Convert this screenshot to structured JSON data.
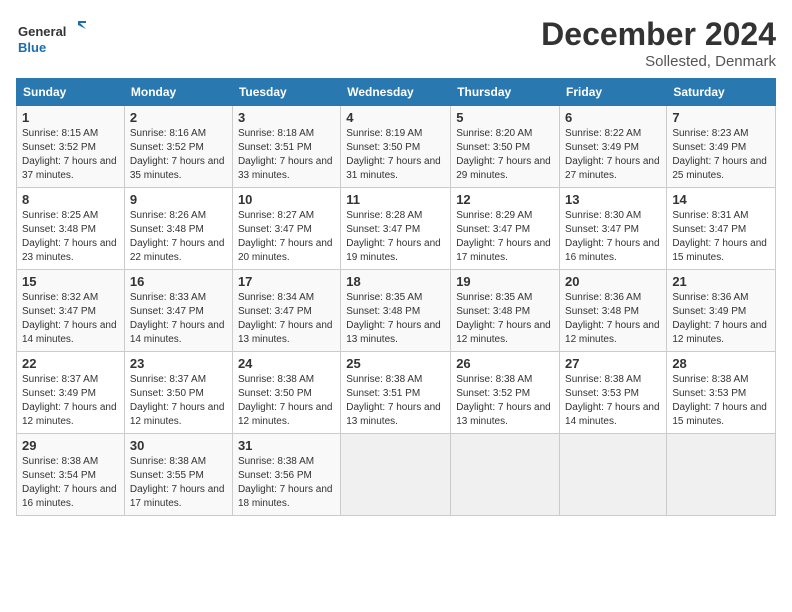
{
  "header": {
    "logo_general": "General",
    "logo_blue": "Blue",
    "month_title": "December 2024",
    "location": "Sollested, Denmark"
  },
  "columns": [
    "Sunday",
    "Monday",
    "Tuesday",
    "Wednesday",
    "Thursday",
    "Friday",
    "Saturday"
  ],
  "weeks": [
    [
      {
        "day": "1",
        "sunrise": "Sunrise: 8:15 AM",
        "sunset": "Sunset: 3:52 PM",
        "daylight": "Daylight: 7 hours and 37 minutes."
      },
      {
        "day": "2",
        "sunrise": "Sunrise: 8:16 AM",
        "sunset": "Sunset: 3:52 PM",
        "daylight": "Daylight: 7 hours and 35 minutes."
      },
      {
        "day": "3",
        "sunrise": "Sunrise: 8:18 AM",
        "sunset": "Sunset: 3:51 PM",
        "daylight": "Daylight: 7 hours and 33 minutes."
      },
      {
        "day": "4",
        "sunrise": "Sunrise: 8:19 AM",
        "sunset": "Sunset: 3:50 PM",
        "daylight": "Daylight: 7 hours and 31 minutes."
      },
      {
        "day": "5",
        "sunrise": "Sunrise: 8:20 AM",
        "sunset": "Sunset: 3:50 PM",
        "daylight": "Daylight: 7 hours and 29 minutes."
      },
      {
        "day": "6",
        "sunrise": "Sunrise: 8:22 AM",
        "sunset": "Sunset: 3:49 PM",
        "daylight": "Daylight: 7 hours and 27 minutes."
      },
      {
        "day": "7",
        "sunrise": "Sunrise: 8:23 AM",
        "sunset": "Sunset: 3:49 PM",
        "daylight": "Daylight: 7 hours and 25 minutes."
      }
    ],
    [
      {
        "day": "8",
        "sunrise": "Sunrise: 8:25 AM",
        "sunset": "Sunset: 3:48 PM",
        "daylight": "Daylight: 7 hours and 23 minutes."
      },
      {
        "day": "9",
        "sunrise": "Sunrise: 8:26 AM",
        "sunset": "Sunset: 3:48 PM",
        "daylight": "Daylight: 7 hours and 22 minutes."
      },
      {
        "day": "10",
        "sunrise": "Sunrise: 8:27 AM",
        "sunset": "Sunset: 3:47 PM",
        "daylight": "Daylight: 7 hours and 20 minutes."
      },
      {
        "day": "11",
        "sunrise": "Sunrise: 8:28 AM",
        "sunset": "Sunset: 3:47 PM",
        "daylight": "Daylight: 7 hours and 19 minutes."
      },
      {
        "day": "12",
        "sunrise": "Sunrise: 8:29 AM",
        "sunset": "Sunset: 3:47 PM",
        "daylight": "Daylight: 7 hours and 17 minutes."
      },
      {
        "day": "13",
        "sunrise": "Sunrise: 8:30 AM",
        "sunset": "Sunset: 3:47 PM",
        "daylight": "Daylight: 7 hours and 16 minutes."
      },
      {
        "day": "14",
        "sunrise": "Sunrise: 8:31 AM",
        "sunset": "Sunset: 3:47 PM",
        "daylight": "Daylight: 7 hours and 15 minutes."
      }
    ],
    [
      {
        "day": "15",
        "sunrise": "Sunrise: 8:32 AM",
        "sunset": "Sunset: 3:47 PM",
        "daylight": "Daylight: 7 hours and 14 minutes."
      },
      {
        "day": "16",
        "sunrise": "Sunrise: 8:33 AM",
        "sunset": "Sunset: 3:47 PM",
        "daylight": "Daylight: 7 hours and 14 minutes."
      },
      {
        "day": "17",
        "sunrise": "Sunrise: 8:34 AM",
        "sunset": "Sunset: 3:47 PM",
        "daylight": "Daylight: 7 hours and 13 minutes."
      },
      {
        "day": "18",
        "sunrise": "Sunrise: 8:35 AM",
        "sunset": "Sunset: 3:48 PM",
        "daylight": "Daylight: 7 hours and 13 minutes."
      },
      {
        "day": "19",
        "sunrise": "Sunrise: 8:35 AM",
        "sunset": "Sunset: 3:48 PM",
        "daylight": "Daylight: 7 hours and 12 minutes."
      },
      {
        "day": "20",
        "sunrise": "Sunrise: 8:36 AM",
        "sunset": "Sunset: 3:48 PM",
        "daylight": "Daylight: 7 hours and 12 minutes."
      },
      {
        "day": "21",
        "sunrise": "Sunrise: 8:36 AM",
        "sunset": "Sunset: 3:49 PM",
        "daylight": "Daylight: 7 hours and 12 minutes."
      }
    ],
    [
      {
        "day": "22",
        "sunrise": "Sunrise: 8:37 AM",
        "sunset": "Sunset: 3:49 PM",
        "daylight": "Daylight: 7 hours and 12 minutes."
      },
      {
        "day": "23",
        "sunrise": "Sunrise: 8:37 AM",
        "sunset": "Sunset: 3:50 PM",
        "daylight": "Daylight: 7 hours and 12 minutes."
      },
      {
        "day": "24",
        "sunrise": "Sunrise: 8:38 AM",
        "sunset": "Sunset: 3:50 PM",
        "daylight": "Daylight: 7 hours and 12 minutes."
      },
      {
        "day": "25",
        "sunrise": "Sunrise: 8:38 AM",
        "sunset": "Sunset: 3:51 PM",
        "daylight": "Daylight: 7 hours and 13 minutes."
      },
      {
        "day": "26",
        "sunrise": "Sunrise: 8:38 AM",
        "sunset": "Sunset: 3:52 PM",
        "daylight": "Daylight: 7 hours and 13 minutes."
      },
      {
        "day": "27",
        "sunrise": "Sunrise: 8:38 AM",
        "sunset": "Sunset: 3:53 PM",
        "daylight": "Daylight: 7 hours and 14 minutes."
      },
      {
        "day": "28",
        "sunrise": "Sunrise: 8:38 AM",
        "sunset": "Sunset: 3:53 PM",
        "daylight": "Daylight: 7 hours and 15 minutes."
      }
    ],
    [
      {
        "day": "29",
        "sunrise": "Sunrise: 8:38 AM",
        "sunset": "Sunset: 3:54 PM",
        "daylight": "Daylight: 7 hours and 16 minutes."
      },
      {
        "day": "30",
        "sunrise": "Sunrise: 8:38 AM",
        "sunset": "Sunset: 3:55 PM",
        "daylight": "Daylight: 7 hours and 17 minutes."
      },
      {
        "day": "31",
        "sunrise": "Sunrise: 8:38 AM",
        "sunset": "Sunset: 3:56 PM",
        "daylight": "Daylight: 7 hours and 18 minutes."
      },
      null,
      null,
      null,
      null
    ]
  ]
}
